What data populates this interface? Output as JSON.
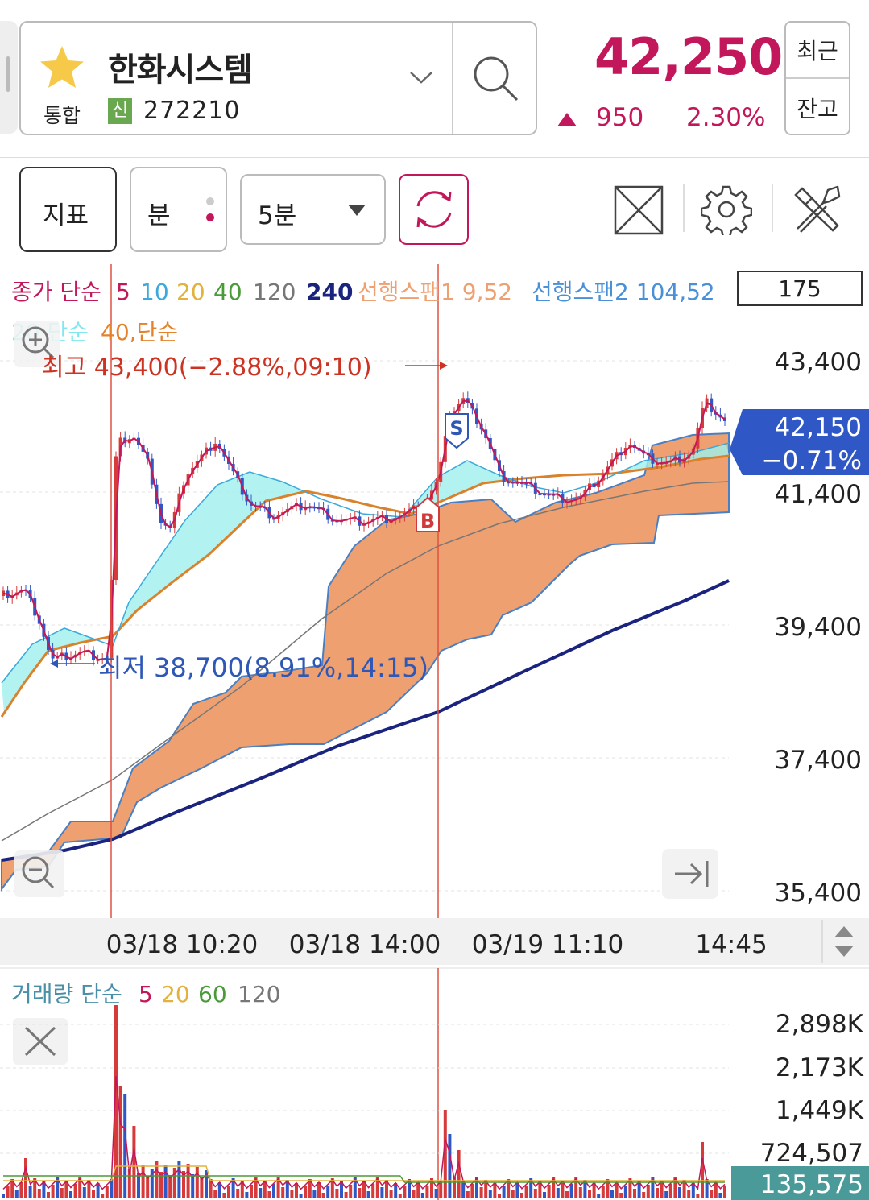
{
  "header": {
    "stock_name": "한화시스템",
    "market": "통합",
    "credit_badge": "신",
    "code": "272210",
    "price": "42,250",
    "change": "950",
    "change_pct": "2.30%",
    "side_buttons": [
      "최근",
      "잔고"
    ],
    "up_color": "#c2185b"
  },
  "toolbar": {
    "indicator_button": "지표",
    "period_button": "분",
    "interval_select": "5분",
    "icons": [
      "refresh-icon",
      "fullscreen-icon",
      "gear-icon",
      "tools-icon"
    ]
  },
  "legend": {
    "ma_title": "종가 단순",
    "ma_periods": [
      "5",
      "10",
      "20",
      "40",
      "120",
      "240"
    ],
    "ma_colors": [
      "#c2185b",
      "#3ba9d9",
      "#e3b23c",
      "#4a9a3a",
      "#777777",
      "#1a237e"
    ],
    "span1": "선행스팬1 9,52",
    "span2": "선행스팬2 104,52",
    "line2_a": "20 단순",
    "line2_b": "40,단순",
    "count_box": "175"
  },
  "annotations": {
    "high": "최고 43,400(−2.88%,09:10)",
    "low": "최저 38,700(8.91%,14:15)",
    "buy_marker": "B",
    "sell_marker": "S"
  },
  "price_axis": {
    "labels": [
      "43,400",
      "41,400",
      "39,400",
      "37,400",
      "35,400"
    ],
    "current_price": "42,150",
    "current_pct": "−0.71%"
  },
  "time_axis": {
    "labels": [
      "03/18 10:20",
      "03/18 14:00",
      "03/19 11:10",
      "14:45"
    ]
  },
  "volume": {
    "legend_title": "거래량 단순",
    "ma_periods": [
      "5",
      "20",
      "60",
      "120"
    ],
    "ma_colors": [
      "#c2185b",
      "#e3b23c",
      "#4a9a3a",
      "#777777"
    ],
    "axis_labels": [
      "2,898K",
      "2,173K",
      "1,449K",
      "724,507"
    ],
    "current": "135,575"
  }
}
